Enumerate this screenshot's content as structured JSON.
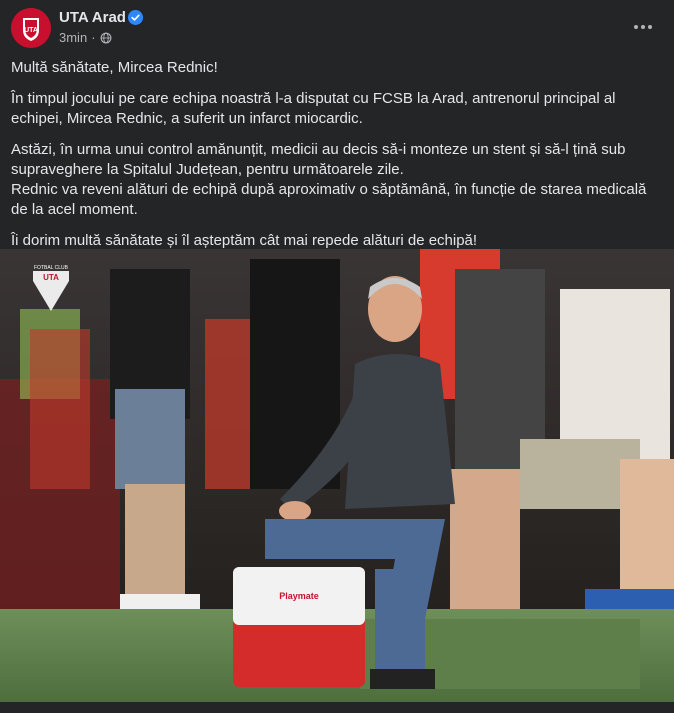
{
  "post": {
    "page_name": "UTA Arad",
    "time": "3min",
    "separator": "·",
    "avatar_text": "UTA",
    "paragraphs": {
      "p1": "Multă sănătate, Mircea Rednic!",
      "p2": "În timpul jocului pe care echipa noastră l-a disputat cu FCSB la Arad, antrenorul principal al echipei, Mircea Rednic, a suferit un infarct miocardic.",
      "p3a": "Astăzi, în urma unui control amănunțit, medicii au decis să-i monteze un stent și să-l țină sub supraveghere la Spitalul Județean, pentru următoarele zile.",
      "p3b": "Rednic va reveni alături de echipă după aproximativ o săptămână, în funcție de starea medicală de la acel moment.",
      "p4": "Îi dorim multă sănătate și îl așteptăm cât mai repede alături de echipă!"
    },
    "image": {
      "watermark_top": "FOTBAL CLUB",
      "watermark_text": "UTA",
      "cooler_brand": "Playmate"
    }
  },
  "icons": {
    "verified": "verified-badge-icon",
    "globe": "globe-icon",
    "more": "more-options-icon"
  },
  "colors": {
    "background": "#242526",
    "text_primary": "#e4e6eb",
    "text_secondary": "#b0b3b8",
    "verified_blue": "#2d88ff",
    "brand_red": "#c8102e"
  }
}
